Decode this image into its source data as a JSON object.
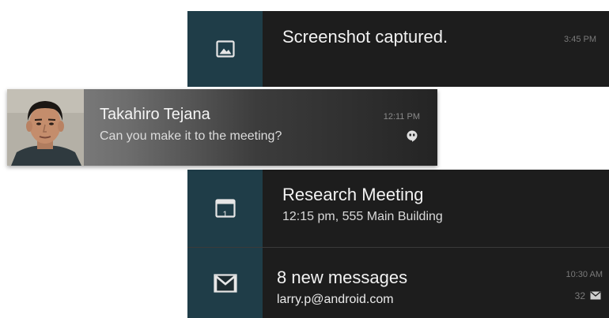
{
  "notifications": {
    "screenshot": {
      "title": "Screenshot captured.",
      "time": "3:45 PM",
      "icon": "image-icon"
    },
    "person": {
      "name": "Takahiro Tejana",
      "message": "Can you make it to the meeting?",
      "time": "12:11 PM",
      "icon": "hangouts-icon"
    },
    "calendar": {
      "title": "Research Meeting",
      "subtitle": "12:15 pm, 555 Main Building",
      "icon_day": "1",
      "icon": "calendar-icon"
    },
    "gmail": {
      "title": "8 new messages",
      "subtitle": "larry.p@android.com",
      "time": "10:30 AM",
      "count": "32",
      "icon": "gmail-icon"
    }
  },
  "colors": {
    "card_bg": "#1d1d1d",
    "icon_column_bg": "#1f3d48"
  }
}
